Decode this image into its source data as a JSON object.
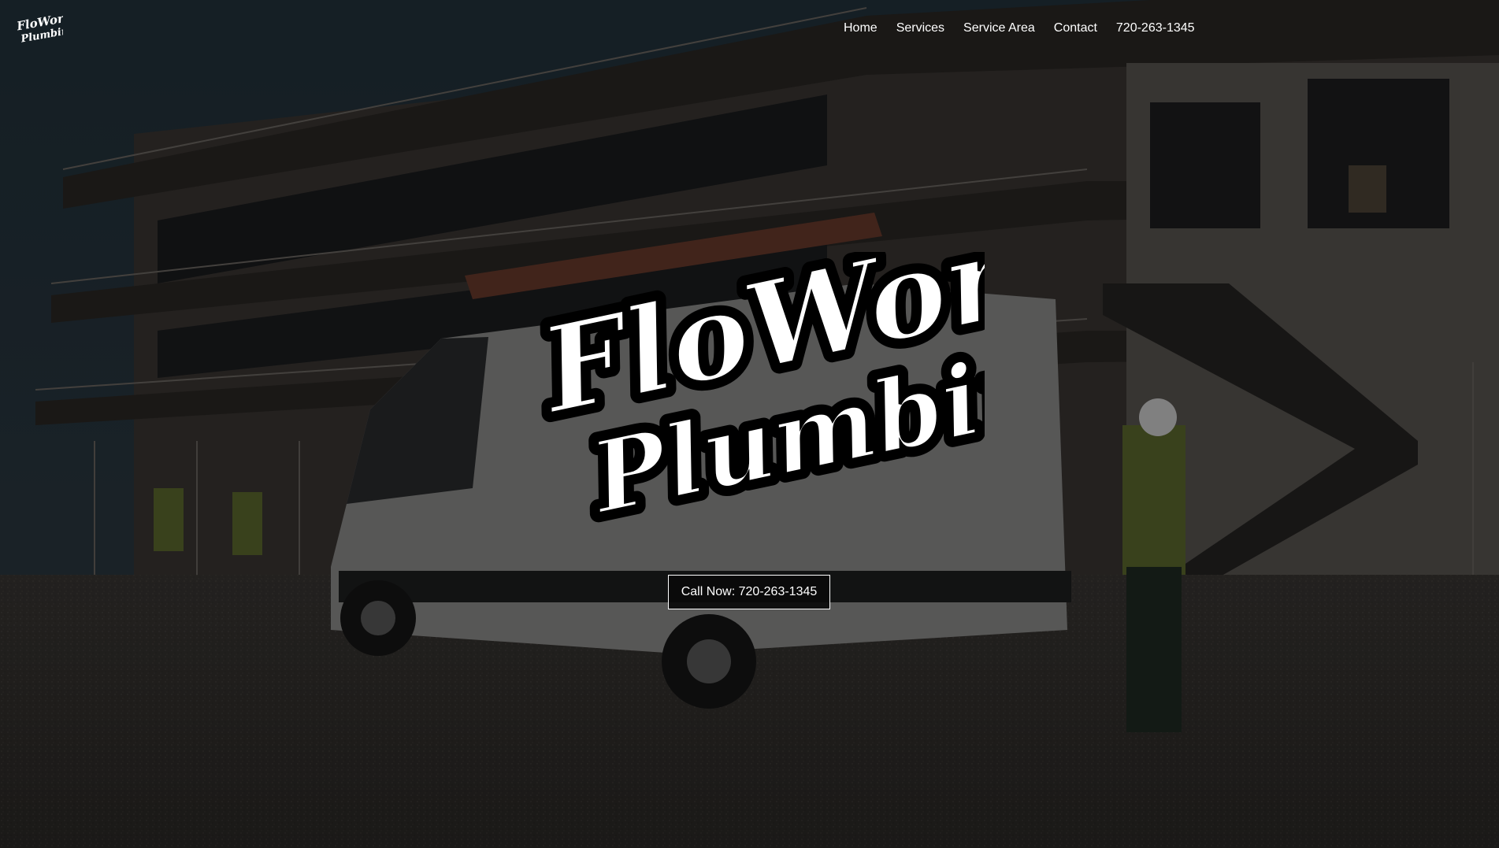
{
  "brand": {
    "logo_text_line1": "FloWorks",
    "logo_text_line2": "Plumbing"
  },
  "nav": {
    "items": [
      {
        "label": "Home"
      },
      {
        "label": "Services"
      },
      {
        "label": "Service Area"
      },
      {
        "label": "Contact"
      },
      {
        "label": "720-263-1345"
      }
    ]
  },
  "hero": {
    "background_description_icon": "construction-site-van-photo",
    "cta_label": "Call Now: 720-263-1345"
  },
  "colors": {
    "overlay": "#000000",
    "text": "#ffffff",
    "cta_border": "#ffffff"
  }
}
